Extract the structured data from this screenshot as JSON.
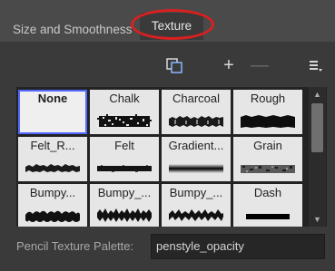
{
  "tabs": {
    "size_smoothness": "Size and Smoothness",
    "texture": "Texture"
  },
  "toolbar": {
    "copy_icon": "duplicate-icon",
    "add_label": "+",
    "remove_label": "—",
    "menu_icon": "menu-icon"
  },
  "textures": [
    {
      "label": "None",
      "selected": true
    },
    {
      "label": "Chalk"
    },
    {
      "label": "Charcoal"
    },
    {
      "label": "Rough"
    },
    {
      "label": "Felt_R..."
    },
    {
      "label": "Felt"
    },
    {
      "label": "Gradient..."
    },
    {
      "label": "Grain"
    },
    {
      "label": "Bumpy..."
    },
    {
      "label": "Bumpy_..."
    },
    {
      "label": "Bumpy_..."
    },
    {
      "label": "Dash"
    }
  ],
  "scrollbar": {
    "up": "▲",
    "down": "▼"
  },
  "footer": {
    "label": "Pencil Texture Palette:",
    "value": "penstyle_opacity"
  },
  "colors": {
    "highlight": "#d92020",
    "selection": "#5468ff"
  }
}
